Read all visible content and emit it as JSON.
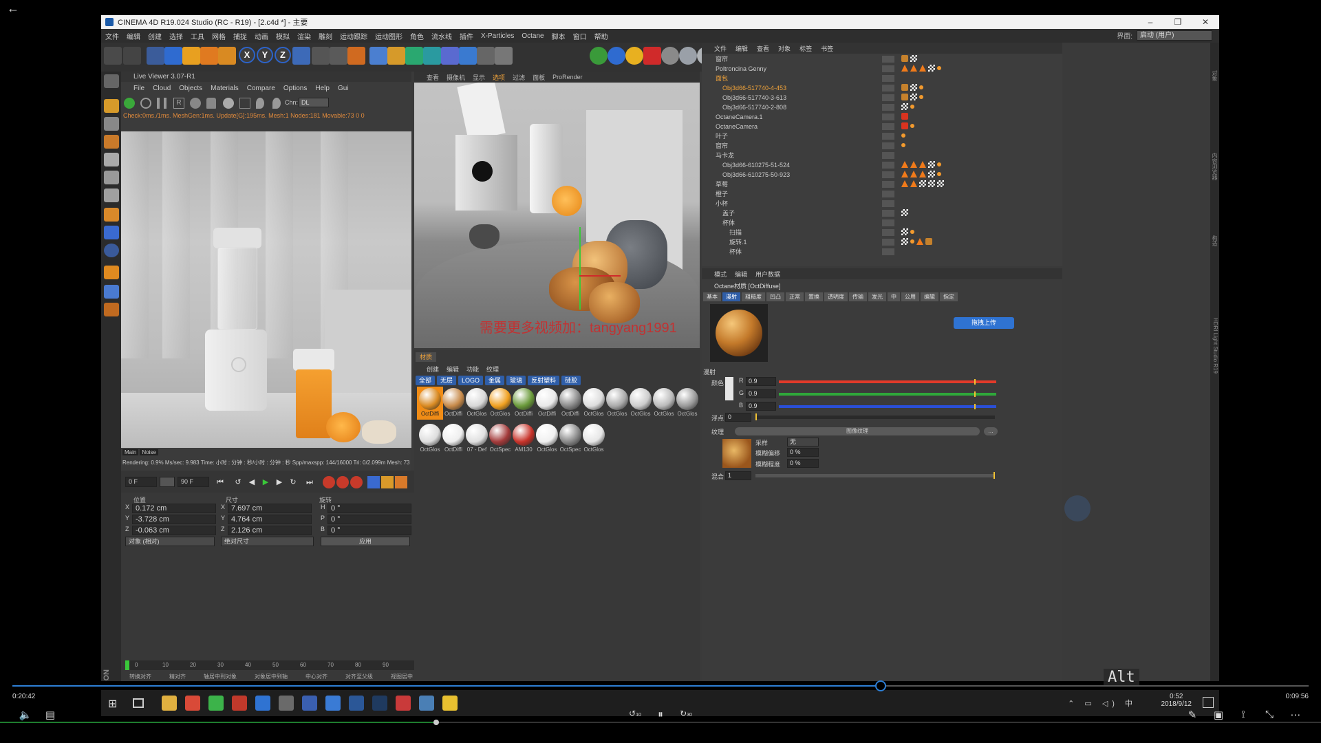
{
  "player": {
    "back_icon": "arrow-left-icon",
    "time_elapsed": "0:20:42",
    "time_remaining": "0:09:56",
    "progress": 0.67,
    "volume": 0.33,
    "rewind_label": "10",
    "forward_label": "30"
  },
  "window": {
    "title": "CINEMA 4D R19.024 Studio (RC - R19) - [2.c4d *] - 主要",
    "minimize": "–",
    "maximize": "❐",
    "close": "✕"
  },
  "menubar": {
    "items": [
      "文件",
      "编辑",
      "创建",
      "选择",
      "工具",
      "网格",
      "捕捉",
      "动画",
      "模拟",
      "渲染",
      "雕刻",
      "运动跟踪",
      "运动图形",
      "角色",
      "流水线",
      "插件",
      "X-Particles",
      "Octane",
      "脚本",
      "窗口",
      "帮助"
    ],
    "layout_label": "界面:",
    "layout_value": "启动 (用户)"
  },
  "live_viewer": {
    "title": "Live Viewer 3.07-R1",
    "menu": [
      "File",
      "Cloud",
      "Objects",
      "Materials",
      "Compare",
      "Options",
      "Help",
      "Gui"
    ],
    "channel_label": "Chn:",
    "channel_value": "DL",
    "status": "Check:0ms./1ms. MeshGen:1ms. Update[G]:195ms. Mesh:1 Nodes:181 Movable:73  0 0",
    "tabs": [
      "Main",
      "Noise"
    ],
    "stats": "Rendering: 0.9%    Ms/sec: 9.983    Time: 小时 : 分钟 : 秒/小时 : 分钟 : 秒    Spp/maxspp: 144/16000  Tri: 0/2.099m  Mesh: 73   Hair"
  },
  "transport": {
    "start_frame": "0 F",
    "end_frame": "90 F"
  },
  "coords": {
    "headers": [
      "位置",
      "尺寸",
      "旋转"
    ],
    "position": [
      {
        "axis": "X",
        "value": "0.172 cm"
      },
      {
        "axis": "Y",
        "value": "-3.728 cm"
      },
      {
        "axis": "Z",
        "value": "-0.063 cm"
      }
    ],
    "size": [
      {
        "axis": "X",
        "value": "7.697 cm"
      },
      {
        "axis": "Y",
        "value": "4.764 cm"
      },
      {
        "axis": "Z",
        "value": "2.126 cm"
      }
    ],
    "rotation": [
      {
        "axis": "H",
        "value": "0 °"
      },
      {
        "axis": "P",
        "value": "0 °"
      },
      {
        "axis": "B",
        "value": "0 °"
      }
    ],
    "mode_object": "对象 (相对)",
    "mode_size": "绝对尺寸",
    "apply": "应用",
    "ruler_ticks": [
      "0",
      "10",
      "20",
      "30",
      "40",
      "50",
      "60",
      "70",
      "80",
      "90"
    ],
    "ruler_field": "0 F",
    "snap_items": [
      "转换对齐",
      "精对齐",
      "轴居中到对象",
      "对象居中到轴",
      "中心对齐",
      "对齐至父级",
      "视图居中"
    ]
  },
  "viewport": {
    "menu": [
      "查看",
      "摄像机",
      "显示",
      "选项",
      "过滤",
      "面板",
      "ProRender"
    ],
    "active_menu": "选项",
    "watermark": "需要更多视频加：tangyang1991"
  },
  "materials": {
    "tab": "材质",
    "menu": [
      "创建",
      "编辑",
      "功能",
      "纹理"
    ],
    "filters": [
      "全部",
      "无层",
      "LOGO",
      "金属",
      "玻璃",
      "反射塑料",
      "硅胶"
    ],
    "items": [
      {
        "label": "OctDiffi",
        "color": "#d98a22"
      },
      {
        "label": "OctDiffi",
        "color": "#c78a4a"
      },
      {
        "label": "OctGlos",
        "color": "#d8d8d8"
      },
      {
        "label": "OctGlos",
        "color": "#f0a020"
      },
      {
        "label": "OctDiffi",
        "color": "#6a9a3a"
      },
      {
        "label": "OctDiffi",
        "color": "#e8e8e8"
      },
      {
        "label": "OctDiffi",
        "color": "#888888"
      },
      {
        "label": "OctGlos",
        "color": "#dddddd"
      },
      {
        "label": "OctGlos",
        "color": "#aaaaaa"
      },
      {
        "label": "OctGlos",
        "color": "#cccccc"
      },
      {
        "label": "OctGlos",
        "color": "#bbbbbb"
      },
      {
        "label": "OctGlos",
        "color": "#999999"
      },
      {
        "label": "OctGlos",
        "color": "#dddddd"
      },
      {
        "label": "OctDiffi",
        "color": "#eeeeee"
      },
      {
        "label": "07 - Def",
        "color": "#e0e0e0"
      },
      {
        "label": "OctSpec",
        "color": "#a33a3a"
      },
      {
        "label": "AM130",
        "color": "#c8332a"
      },
      {
        "label": "OctGlos",
        "color": "#f0f0f0"
      },
      {
        "label": "OctSpec",
        "color": "#888888"
      },
      {
        "label": "OctGlos",
        "color": "#e6e6e6"
      }
    ]
  },
  "objects": {
    "menu": [
      "文件",
      "编辑",
      "查看",
      "对象",
      "标签",
      "书签"
    ],
    "rows": [
      {
        "name": "窗帘",
        "indent": 1,
        "selected": false,
        "tags": [
          "tex",
          "chk"
        ]
      },
      {
        "name": "Poltroncina Genny",
        "indent": 1,
        "selected": false,
        "tags": [
          "tri",
          "tri",
          "tri",
          "chk",
          "dot"
        ]
      },
      {
        "name": "面包",
        "indent": 1,
        "selected": true,
        "tags": []
      },
      {
        "name": "Obj3d66-517740-4-453",
        "indent": 2,
        "selected": true,
        "tags": [
          "tex",
          "chk",
          "dot"
        ]
      },
      {
        "name": "Obj3d66-517740-3-613",
        "indent": 2,
        "selected": false,
        "tags": [
          "tex",
          "chk",
          "dot"
        ]
      },
      {
        "name": "Obj3d66-517740-2-808",
        "indent": 2,
        "selected": false,
        "tags": [
          "chk",
          "dot"
        ]
      },
      {
        "name": "OctaneCamera.1",
        "indent": 1,
        "selected": false,
        "tags": [
          "cam"
        ]
      },
      {
        "name": "OctaneCamera",
        "indent": 1,
        "selected": false,
        "tags": [
          "cam",
          "dot"
        ]
      },
      {
        "name": "叶子",
        "indent": 1,
        "selected": false,
        "tags": [
          "dot"
        ]
      },
      {
        "name": "窗帘",
        "indent": 1,
        "selected": false,
        "tags": [
          "dot"
        ]
      },
      {
        "name": "马卡龙",
        "indent": 1,
        "selected": false,
        "tags": []
      },
      {
        "name": "Obj3d66-610275-51-524",
        "indent": 2,
        "selected": false,
        "tags": [
          "tri",
          "tri",
          "tri",
          "chk",
          "dot"
        ]
      },
      {
        "name": "Obj3d66-610275-50-923",
        "indent": 2,
        "selected": false,
        "tags": [
          "tri",
          "tri",
          "tri",
          "chk",
          "dot"
        ]
      },
      {
        "name": "草莓",
        "indent": 1,
        "selected": false,
        "tags": [
          "tri",
          "tri",
          "chk",
          "chk",
          "chk"
        ]
      },
      {
        "name": "橙子",
        "indent": 1,
        "selected": false,
        "tags": []
      },
      {
        "name": "小杯",
        "indent": 1,
        "selected": false,
        "tags": []
      },
      {
        "name": "盖子",
        "indent": 2,
        "selected": false,
        "tags": [
          "chk"
        ]
      },
      {
        "name": "杯体",
        "indent": 2,
        "selected": false,
        "tags": []
      },
      {
        "name": "扫描",
        "indent": 3,
        "selected": false,
        "tags": [
          "chk",
          "dot"
        ]
      },
      {
        "name": "旋转.1",
        "indent": 3,
        "selected": false,
        "tags": [
          "chk",
          "dot",
          "tri",
          "tex"
        ]
      },
      {
        "name": "杯体",
        "indent": 3,
        "selected": false,
        "tags": []
      }
    ]
  },
  "attributes": {
    "menu": [
      "模式",
      "编辑",
      "用户数据"
    ],
    "title": "Octane材质 [OctDiffuse]",
    "tabs": [
      "基本",
      "漫射",
      "粗糙度",
      "凹凸",
      "正常",
      "置换",
      "透明度",
      "传输",
      "发光",
      "中",
      "公用",
      "编辑",
      "指定"
    ],
    "active_tab": "漫射",
    "upload_button": "拖拽上传",
    "section": "漫射",
    "color_label": "颜色",
    "channels": [
      {
        "name": "R",
        "value": "0.9",
        "color": "#e23a2a"
      },
      {
        "name": "G",
        "value": "0.9",
        "color": "#2fa83a"
      },
      {
        "name": "B",
        "value": "0.9",
        "color": "#2a4fd6"
      }
    ],
    "float_label": "浮点",
    "float_value": "0",
    "texture_label": "纹理",
    "texture_button": "图像纹理",
    "sampling_label": "采样",
    "sampling_value": "无",
    "blur_offset_label": "模糊偏移",
    "blur_offset_value": "0 %",
    "blur_scale_label": "模糊程度",
    "blur_scale_value": "0 %",
    "mix_label": "混合",
    "mix_value": "1"
  },
  "taskbar": {
    "clock_time": "0:52",
    "clock_date": "2018/9/12",
    "ime": "中",
    "apps": [
      {
        "name": "file-explorer-icon",
        "color": "#e0b040"
      },
      {
        "name": "chrome-icon",
        "color": "#d94a38"
      },
      {
        "name": "wechat-icon",
        "color": "#3cb34a"
      },
      {
        "name": "app-red-icon",
        "color": "#c0392b"
      },
      {
        "name": "app-blue-icon",
        "color": "#2f73d2"
      },
      {
        "name": "cinema4d-icon",
        "color": "#6a6a6a"
      },
      {
        "name": "app-circle-icon",
        "color": "#3a5fb0"
      },
      {
        "name": "baidu-netdisk-icon",
        "color": "#3a7bd5"
      },
      {
        "name": "word-icon",
        "color": "#2b5797"
      },
      {
        "name": "photoshop-icon",
        "color": "#1f3a5f"
      },
      {
        "name": "app-video-icon",
        "color": "#c93a3a"
      },
      {
        "name": "app-window-icon",
        "color": "#4a7fb5"
      },
      {
        "name": "app-notes-icon",
        "color": "#e8c030"
      }
    ]
  },
  "alt_key": "Alt",
  "side_labels": [
    "对象",
    "内容浏览器",
    "构造",
    "HDRI Light Studio R19"
  ]
}
